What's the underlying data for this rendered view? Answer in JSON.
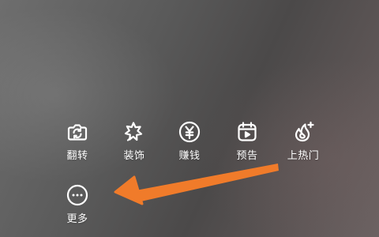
{
  "toolbar": {
    "items": [
      {
        "label": "翻转",
        "icon": "flip-camera-icon"
      },
      {
        "label": "装饰",
        "icon": "decoration-star-icon"
      },
      {
        "label": "赚钱",
        "icon": "yen-money-icon"
      },
      {
        "label": "预告",
        "icon": "preview-calendar-icon"
      },
      {
        "label": "上热门",
        "icon": "trending-flame-icon"
      },
      {
        "label": "更多",
        "icon": "more-dots-icon"
      }
    ]
  },
  "annotation": {
    "arrow_color": "#f07b2a",
    "points_to": "more-button"
  },
  "colors": {
    "icon": "#ffffff",
    "label": "#ffffff",
    "background": "#5a5858"
  }
}
